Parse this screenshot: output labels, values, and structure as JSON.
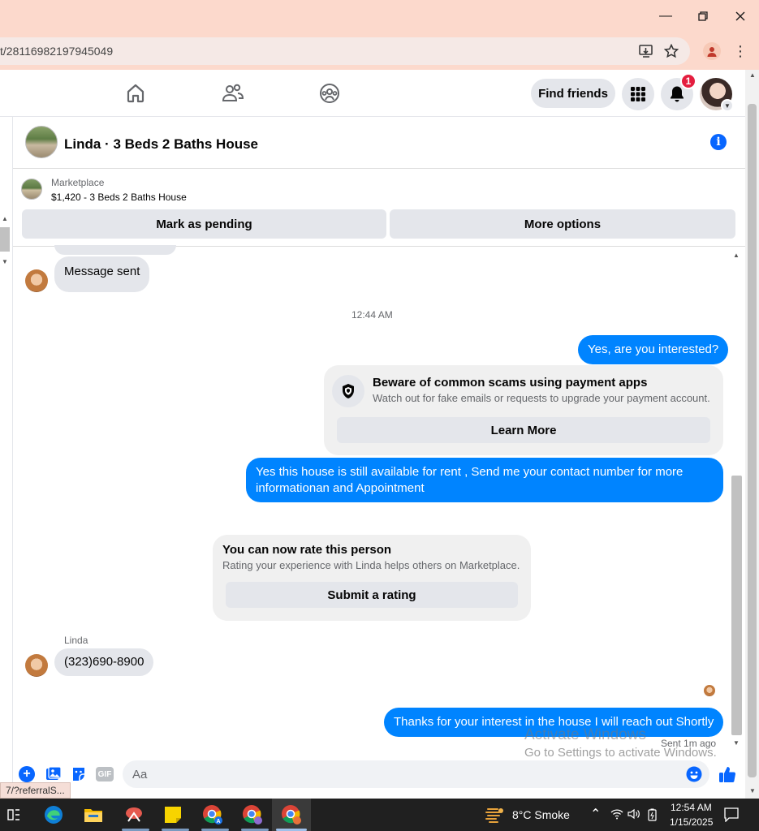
{
  "browser": {
    "url": "t/28116982197945049",
    "status_url": "7/?referralS..."
  },
  "fb_nav": {
    "find_friends": "Find friends",
    "notification_count": "1"
  },
  "chat": {
    "title": "Linda · 3 Beds 2 Baths House",
    "marketplace_label": "Marketplace",
    "listing": "$1,420 - 3 Beds 2 Baths House",
    "mark_pending": "Mark as pending",
    "more_options": "More options"
  },
  "messages": {
    "sent_notice": "Message sent",
    "time": "12:44 AM",
    "out1": "Yes, are you interested?",
    "scam_title": "Beware of common scams using payment apps",
    "scam_body": "Watch out for fake emails or requests to upgrade your payment account.",
    "learn_more": "Learn More",
    "out2": "Yes this house is still available for rent , Send me your contact number for more informationan and Appointment",
    "rate_title": "You can now rate this person",
    "rate_body": "Rating your experience with Linda helps others on Marketplace.",
    "submit_rating": "Submit a rating",
    "sender_name": "Linda",
    "in_phone": "(323)690-8900",
    "out3": "Thanks for your interest in the house I will reach out Shortly",
    "sent_status": "Sent 1m ago"
  },
  "composer": {
    "placeholder": "Aa",
    "gif_label": "GIF"
  },
  "watermark": {
    "line1": "Activate Windows",
    "line2": "Go to Settings to activate Windows."
  },
  "taskbar": {
    "weather": "8°C  Smoke",
    "time": "12:54 AM",
    "date": "1/15/2025"
  }
}
